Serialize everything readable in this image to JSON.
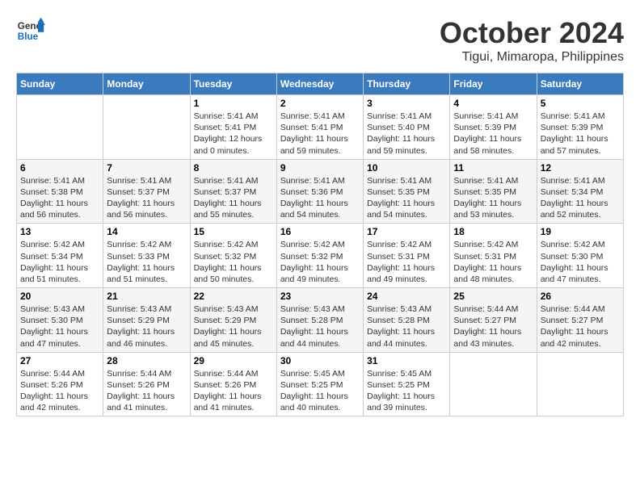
{
  "logo": {
    "line1": "General",
    "line2": "Blue"
  },
  "title": "October 2024",
  "subtitle": "Tigui, Mimaropa, Philippines",
  "days_of_week": [
    "Sunday",
    "Monday",
    "Tuesday",
    "Wednesday",
    "Thursday",
    "Friday",
    "Saturday"
  ],
  "weeks": [
    [
      {
        "day": "",
        "content": ""
      },
      {
        "day": "",
        "content": ""
      },
      {
        "day": "1",
        "content": "Sunrise: 5:41 AM\nSunset: 5:41 PM\nDaylight: 12 hours\nand 0 minutes."
      },
      {
        "day": "2",
        "content": "Sunrise: 5:41 AM\nSunset: 5:41 PM\nDaylight: 11 hours\nand 59 minutes."
      },
      {
        "day": "3",
        "content": "Sunrise: 5:41 AM\nSunset: 5:40 PM\nDaylight: 11 hours\nand 59 minutes."
      },
      {
        "day": "4",
        "content": "Sunrise: 5:41 AM\nSunset: 5:39 PM\nDaylight: 11 hours\nand 58 minutes."
      },
      {
        "day": "5",
        "content": "Sunrise: 5:41 AM\nSunset: 5:39 PM\nDaylight: 11 hours\nand 57 minutes."
      }
    ],
    [
      {
        "day": "6",
        "content": "Sunrise: 5:41 AM\nSunset: 5:38 PM\nDaylight: 11 hours\nand 56 minutes."
      },
      {
        "day": "7",
        "content": "Sunrise: 5:41 AM\nSunset: 5:37 PM\nDaylight: 11 hours\nand 56 minutes."
      },
      {
        "day": "8",
        "content": "Sunrise: 5:41 AM\nSunset: 5:37 PM\nDaylight: 11 hours\nand 55 minutes."
      },
      {
        "day": "9",
        "content": "Sunrise: 5:41 AM\nSunset: 5:36 PM\nDaylight: 11 hours\nand 54 minutes."
      },
      {
        "day": "10",
        "content": "Sunrise: 5:41 AM\nSunset: 5:35 PM\nDaylight: 11 hours\nand 54 minutes."
      },
      {
        "day": "11",
        "content": "Sunrise: 5:41 AM\nSunset: 5:35 PM\nDaylight: 11 hours\nand 53 minutes."
      },
      {
        "day": "12",
        "content": "Sunrise: 5:41 AM\nSunset: 5:34 PM\nDaylight: 11 hours\nand 52 minutes."
      }
    ],
    [
      {
        "day": "13",
        "content": "Sunrise: 5:42 AM\nSunset: 5:34 PM\nDaylight: 11 hours\nand 51 minutes."
      },
      {
        "day": "14",
        "content": "Sunrise: 5:42 AM\nSunset: 5:33 PM\nDaylight: 11 hours\nand 51 minutes."
      },
      {
        "day": "15",
        "content": "Sunrise: 5:42 AM\nSunset: 5:32 PM\nDaylight: 11 hours\nand 50 minutes."
      },
      {
        "day": "16",
        "content": "Sunrise: 5:42 AM\nSunset: 5:32 PM\nDaylight: 11 hours\nand 49 minutes."
      },
      {
        "day": "17",
        "content": "Sunrise: 5:42 AM\nSunset: 5:31 PM\nDaylight: 11 hours\nand 49 minutes."
      },
      {
        "day": "18",
        "content": "Sunrise: 5:42 AM\nSunset: 5:31 PM\nDaylight: 11 hours\nand 48 minutes."
      },
      {
        "day": "19",
        "content": "Sunrise: 5:42 AM\nSunset: 5:30 PM\nDaylight: 11 hours\nand 47 minutes."
      }
    ],
    [
      {
        "day": "20",
        "content": "Sunrise: 5:43 AM\nSunset: 5:30 PM\nDaylight: 11 hours\nand 47 minutes."
      },
      {
        "day": "21",
        "content": "Sunrise: 5:43 AM\nSunset: 5:29 PM\nDaylight: 11 hours\nand 46 minutes."
      },
      {
        "day": "22",
        "content": "Sunrise: 5:43 AM\nSunset: 5:29 PM\nDaylight: 11 hours\nand 45 minutes."
      },
      {
        "day": "23",
        "content": "Sunrise: 5:43 AM\nSunset: 5:28 PM\nDaylight: 11 hours\nand 44 minutes."
      },
      {
        "day": "24",
        "content": "Sunrise: 5:43 AM\nSunset: 5:28 PM\nDaylight: 11 hours\nand 44 minutes."
      },
      {
        "day": "25",
        "content": "Sunrise: 5:44 AM\nSunset: 5:27 PM\nDaylight: 11 hours\nand 43 minutes."
      },
      {
        "day": "26",
        "content": "Sunrise: 5:44 AM\nSunset: 5:27 PM\nDaylight: 11 hours\nand 42 minutes."
      }
    ],
    [
      {
        "day": "27",
        "content": "Sunrise: 5:44 AM\nSunset: 5:26 PM\nDaylight: 11 hours\nand 42 minutes."
      },
      {
        "day": "28",
        "content": "Sunrise: 5:44 AM\nSunset: 5:26 PM\nDaylight: 11 hours\nand 41 minutes."
      },
      {
        "day": "29",
        "content": "Sunrise: 5:44 AM\nSunset: 5:26 PM\nDaylight: 11 hours\nand 41 minutes."
      },
      {
        "day": "30",
        "content": "Sunrise: 5:45 AM\nSunset: 5:25 PM\nDaylight: 11 hours\nand 40 minutes."
      },
      {
        "day": "31",
        "content": "Sunrise: 5:45 AM\nSunset: 5:25 PM\nDaylight: 11 hours\nand 39 minutes."
      },
      {
        "day": "",
        "content": ""
      },
      {
        "day": "",
        "content": ""
      }
    ]
  ]
}
